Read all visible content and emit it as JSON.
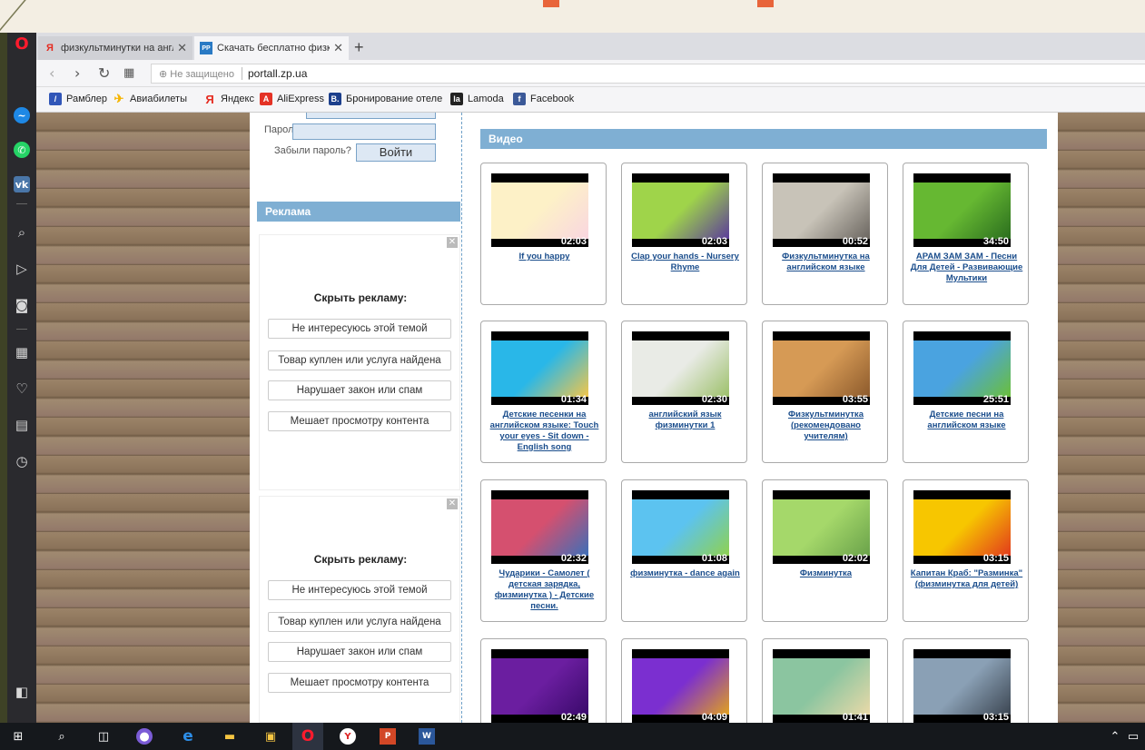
{
  "browser": {
    "tabs": [
      {
        "title": "физкультминутки на англ",
        "favicon": "Я",
        "active": false
      },
      {
        "title": "Скачать бесплатно физку",
        "favicon": "PP",
        "active": true
      }
    ],
    "new_tab": "+",
    "address": {
      "security": "Не защищено",
      "url": "portall.zp.ua"
    },
    "bookmarks": [
      {
        "label": "Рамблер",
        "icon": "/",
        "color": "#3156b8"
      },
      {
        "label": "Авиабилеты",
        "icon": "✈",
        "color": "#f5b400"
      },
      {
        "label": "Яндекс",
        "icon": "Я",
        "color": "#e52b20"
      },
      {
        "label": "AliExpress",
        "icon": "A",
        "color": "#e43225"
      },
      {
        "label": "Бронирование отеле",
        "icon": "B.",
        "color": "#1c3f8c"
      },
      {
        "label": "Lamoda",
        "icon": "la",
        "color": "#222222"
      },
      {
        "label": "Facebook",
        "icon": "f",
        "color": "#3b5998"
      }
    ]
  },
  "login": {
    "password_label": "Пароль",
    "forgot_label": "Забыли пароль?",
    "submit_label": "Войти"
  },
  "ads": {
    "heading": "Реклама",
    "blocks": [
      {
        "title": "Скрыть рекламу:",
        "options": [
          "Не интересуюсь этой темой",
          "Товар куплен или услуга найдена",
          "Нарушает закон или спам",
          "Мешает просмотру контента"
        ]
      },
      {
        "title": "Скрыть рекламу:",
        "options": [
          "Не интересуюсь этой темой",
          "Товар куплен или услуга найдена",
          "Нарушает закон или спам",
          "Мешает просмотру контента"
        ]
      }
    ]
  },
  "video": {
    "heading": "Видео",
    "items": [
      {
        "title": "If you happy",
        "duration": "02:03",
        "colors": [
          "#fdf1c7",
          "#f9d6e0"
        ]
      },
      {
        "title": "Clap your hands - Nursery Rhyme",
        "duration": "02:03",
        "colors": [
          "#9fd44a",
          "#5b3c9a"
        ]
      },
      {
        "title": "Физкультминутка на английском языке",
        "duration": "00:52",
        "colors": [
          "#c8c3b8",
          "#6b6660"
        ]
      },
      {
        "title": "APAM ЗАМ ЗАМ - Песни Для Детей - Развивающие Мультики",
        "duration": "34:50",
        "colors": [
          "#66b832",
          "#2b6e1e"
        ]
      },
      {
        "title": "Детские песенки на английском языке: Touch your eyes - Sit down - English song",
        "duration": "01:34",
        "colors": [
          "#29b7e8",
          "#f2c64a"
        ]
      },
      {
        "title": "английский язык физминутки 1",
        "duration": "02:30",
        "colors": [
          "#e9ebe6",
          "#9cc06a"
        ]
      },
      {
        "title": "Физкультминутка (рекомендовано учителям)",
        "duration": "03:55",
        "colors": [
          "#d69a55",
          "#8c5a2c"
        ]
      },
      {
        "title": "Детские песни на английском языке",
        "duration": "25:51",
        "colors": [
          "#4aa3e0",
          "#6bbf3a"
        ]
      },
      {
        "title": "Чударики - Самолет ( детская зарядка, физминутка ) - Детские песни.",
        "duration": "02:32",
        "colors": [
          "#d5506f",
          "#3c6fb8"
        ]
      },
      {
        "title": "физминутка - dance again",
        "duration": "01:08",
        "colors": [
          "#5cc3f0",
          "#8fd14f"
        ]
      },
      {
        "title": "Физминутка",
        "duration": "02:02",
        "colors": [
          "#a5d86a",
          "#6aa24a"
        ]
      },
      {
        "title": "Капитан Краб: \"Разминка\" (физминутка для детей)",
        "duration": "03:15",
        "colors": [
          "#f7c600",
          "#e23a1c"
        ]
      },
      {
        "title": "",
        "duration": "02:49",
        "colors": [
          "#6b1ea0",
          "#3a0a6b"
        ]
      },
      {
        "title": "",
        "duration": "04:09",
        "colors": [
          "#7b2fd0",
          "#e0a020"
        ]
      },
      {
        "title": "",
        "duration": "01:41",
        "colors": [
          "#8bc5a0",
          "#e9d9a8"
        ]
      },
      {
        "title": "",
        "duration": "03:15",
        "colors": [
          "#8aa0b5",
          "#3c4652"
        ]
      }
    ]
  }
}
